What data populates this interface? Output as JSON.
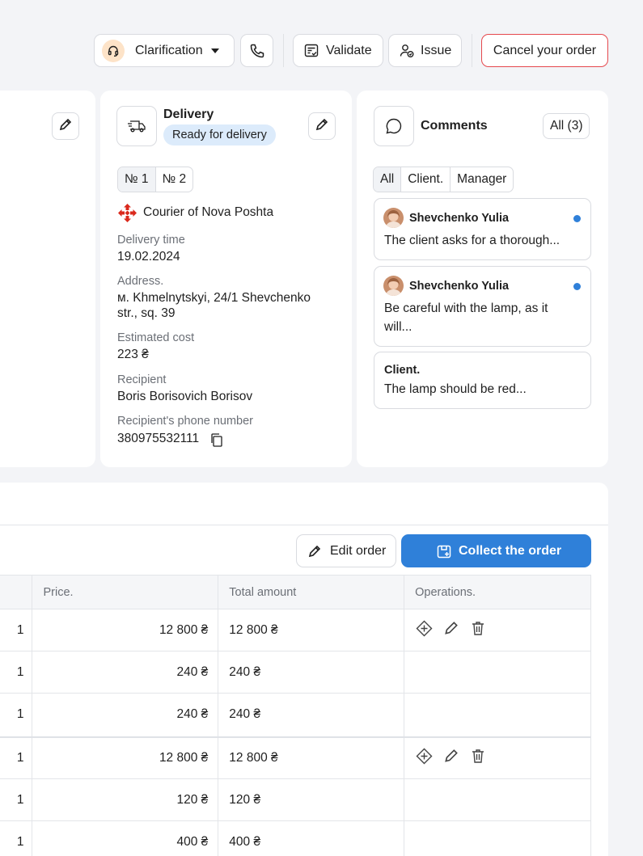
{
  "header": {
    "status_select": {
      "label": "Clarification",
      "icon": "headset-icon",
      "chevron": "chevron-down-icon"
    },
    "call_button_icon": "phone-icon",
    "validate_label": "Validate",
    "issue_label": "Issue",
    "cancel_label": "Cancel your order"
  },
  "delivery": {
    "title": "Delivery",
    "status_badge": "Ready for delivery",
    "tabs": [
      "№ 1",
      "№ 2"
    ],
    "carrier": "Courier of Nova Poshta",
    "fields": {
      "time_label": "Delivery time",
      "time_value": "19.02.2024",
      "address_label": "Address.",
      "address_line1": "м. Khmelnytskyi, 24/1 Shevchenko",
      "address_line2": "str., sq. 39",
      "cost_label": "Estimated cost",
      "cost_value": "223 ₴",
      "recipient_label": "Recipient",
      "recipient_value": "Boris Borisovich Borisov",
      "phone_label": "Recipient's phone number",
      "phone_value": "380975532111"
    }
  },
  "comments": {
    "title": "Comments",
    "filter_all": "All (3)",
    "tabs": [
      "All",
      "Client.",
      "Manager"
    ],
    "items": [
      {
        "author": "Shevchenko Yulia",
        "text": "The client asks for a thorough...",
        "unread": true
      },
      {
        "author": "Shevchenko Yulia",
        "text_line1": "Be careful with the lamp, as it",
        "text_line2": "will...",
        "unread": true
      },
      {
        "author": "Client.",
        "text": "The lamp should be red..."
      }
    ]
  },
  "order": {
    "edit_label": "Edit order",
    "collect_label": "Collect the order",
    "columns": {
      "price": "Price.",
      "total": "Total amount",
      "operations": "Operations."
    },
    "rows": [
      {
        "qty": "1",
        "price": "12 800 ₴",
        "total": "12 800 ₴",
        "ops": true
      },
      {
        "qty": "1",
        "price": "240 ₴",
        "total": "240 ₴",
        "ops": false
      },
      {
        "qty": "1",
        "price": "240 ₴",
        "total": "240 ₴",
        "ops": false
      },
      {
        "qty": "1",
        "price": "12 800 ₴",
        "total": "12 800 ₴",
        "ops": true
      },
      {
        "qty": "1",
        "price": "120 ₴",
        "total": "120 ₴",
        "ops": false
      },
      {
        "qty": "1",
        "price": "400 ₴",
        "total": "400 ₴",
        "ops": false
      }
    ]
  },
  "colors": {
    "accent": "#2f80d9",
    "danger": "#e5484d",
    "badge_bg": "#dcebfb",
    "nova_poshta": "#da291c"
  }
}
